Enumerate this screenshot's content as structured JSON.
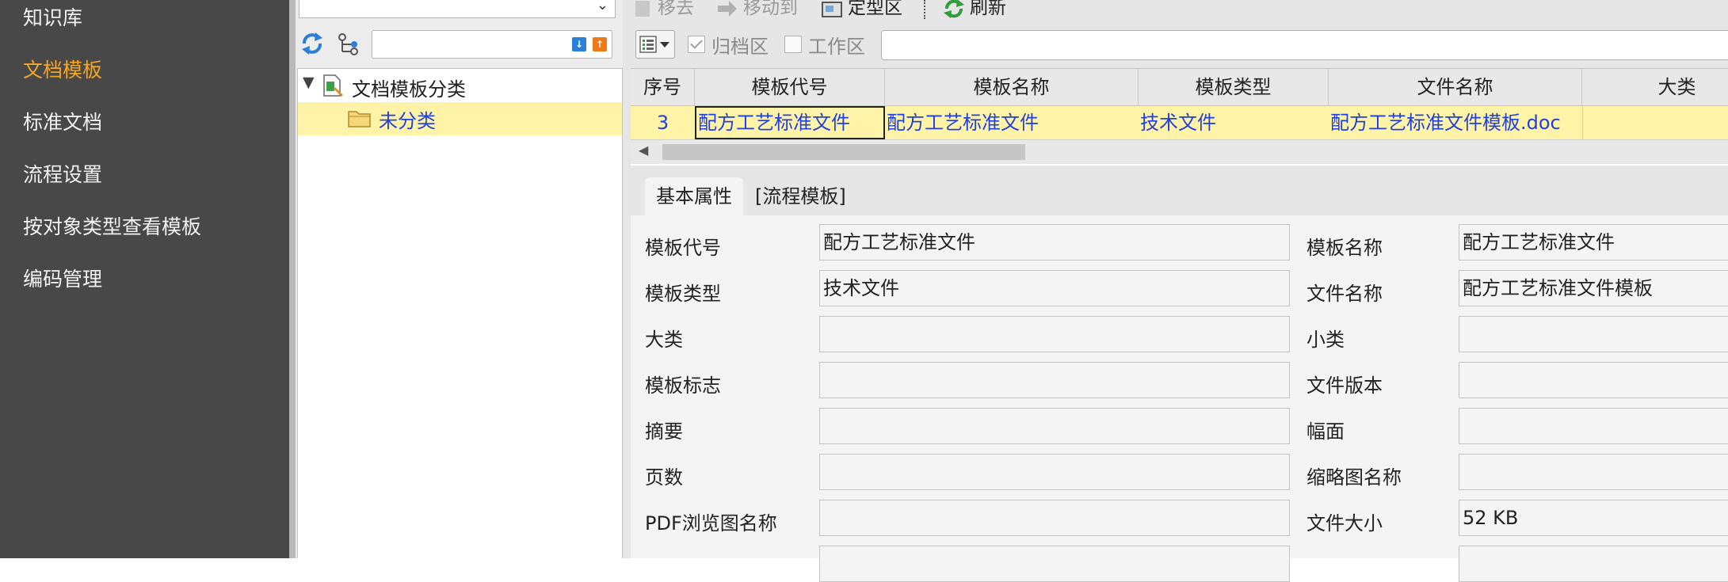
{
  "nav": {
    "items": [
      {
        "label": "知识库"
      },
      {
        "label": "文档模板",
        "active": true
      },
      {
        "label": "标准文档"
      },
      {
        "label": "流程设置"
      },
      {
        "label": "按对象类型查看模板"
      },
      {
        "label": "编码管理"
      }
    ]
  },
  "tree": {
    "root_label": "文档模板分类",
    "child_label": "未分类"
  },
  "toolbar": {
    "move_out": "移去",
    "move_to": "移动到",
    "finalize": "定型区",
    "refresh": "刷新"
  },
  "filters": {
    "archive_label": "归档区",
    "archive_checked": true,
    "work_label": "工作区",
    "work_checked": false
  },
  "grid": {
    "columns": [
      "序号",
      "模板代号",
      "模板名称",
      "模板类型",
      "文件名称",
      "大类"
    ],
    "rows": [
      {
        "seq": "3",
        "code": "配方工艺标准文件",
        "name": "配方工艺标准文件",
        "type": "技术文件",
        "file": "配方工艺标准文件模板.doc",
        "category": ""
      }
    ]
  },
  "tabs": [
    "基本属性",
    "[流程模板]"
  ],
  "form": {
    "fields": [
      {
        "label": "模板代号",
        "value": "配方工艺标准文件"
      },
      {
        "label": "模板名称",
        "value": "配方工艺标准文件"
      },
      {
        "label": "模板类型",
        "value": "技术文件"
      },
      {
        "label": "文件名称",
        "value": "配方工艺标准文件模板"
      },
      {
        "label": "大类",
        "value": ""
      },
      {
        "label": "小类",
        "value": ""
      },
      {
        "label": "模板标志",
        "value": ""
      },
      {
        "label": "文件版本",
        "value": ""
      },
      {
        "label": "摘要",
        "value": ""
      },
      {
        "label": "幅面",
        "value": ""
      },
      {
        "label": "页数",
        "value": ""
      },
      {
        "label": "缩略图名称",
        "value": ""
      },
      {
        "label": "PDF浏览图名称",
        "value": ""
      },
      {
        "label": "文件大小",
        "value": "52 KB"
      }
    ]
  },
  "colors": {
    "nav_bg": "#484848",
    "nav_active": "#f5a623",
    "selection_bg": "#fff3a8",
    "link_blue": "#1f3fe0"
  }
}
